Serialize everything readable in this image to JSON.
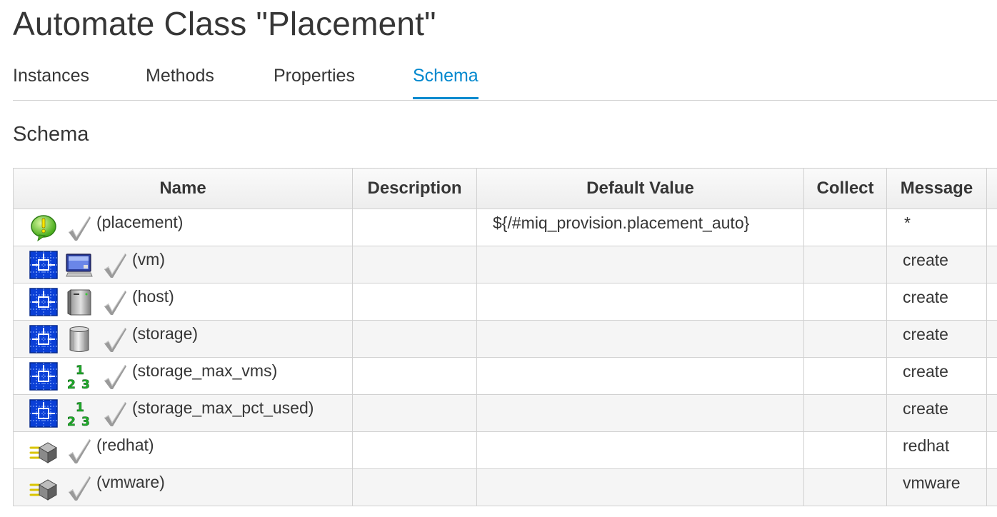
{
  "header": {
    "title": "Automate Class \"Placement\""
  },
  "tabs": [
    {
      "label": "Instances",
      "active": false
    },
    {
      "label": "Methods",
      "active": false
    },
    {
      "label": "Properties",
      "active": false
    },
    {
      "label": "Schema",
      "active": true
    }
  ],
  "section": {
    "title": "Schema"
  },
  "table": {
    "columns": [
      "Name",
      "Description",
      "Default Value",
      "Collect",
      "Message"
    ],
    "rows": [
      {
        "icons": [
          "exclamation-bubble-icon",
          "checkmark-icon"
        ],
        "name": "(placement)",
        "description": "",
        "default_value": "${/#miq_provision.placement_auto}",
        "collect": "",
        "message": "*"
      },
      {
        "icons": [
          "relationship-grid-icon",
          "monitor-icon",
          "checkmark-icon"
        ],
        "name": "(vm)",
        "description": "",
        "default_value": "",
        "collect": "",
        "message": "create"
      },
      {
        "icons": [
          "relationship-grid-icon",
          "server-box-icon",
          "checkmark-icon"
        ],
        "name": "(host)",
        "description": "",
        "default_value": "",
        "collect": "",
        "message": "create"
      },
      {
        "icons": [
          "relationship-grid-icon",
          "storage-cylinder-icon",
          "checkmark-icon"
        ],
        "name": "(storage)",
        "description": "",
        "default_value": "",
        "collect": "",
        "message": "create"
      },
      {
        "icons": [
          "relationship-grid-icon",
          "integer-123-icon",
          "checkmark-icon"
        ],
        "name": "(storage_max_vms)",
        "description": "",
        "default_value": "",
        "collect": "",
        "message": "create"
      },
      {
        "icons": [
          "relationship-grid-icon",
          "integer-123-icon",
          "checkmark-icon"
        ],
        "name": "(storage_max_pct_used)",
        "description": "",
        "default_value": "",
        "collect": "",
        "message": "create"
      },
      {
        "icons": [
          "method-cube-icon",
          "checkmark-icon"
        ],
        "name": "(redhat)",
        "description": "",
        "default_value": "",
        "collect": "",
        "message": "redhat"
      },
      {
        "icons": [
          "method-cube-icon",
          "checkmark-icon"
        ],
        "name": "(vmware)",
        "description": "",
        "default_value": "",
        "collect": "",
        "message": "vmware"
      }
    ]
  },
  "colors": {
    "accent": "#0088ce",
    "text": "#363636",
    "border": "#d1d1d1",
    "row_alt": "#f5f5f5"
  }
}
